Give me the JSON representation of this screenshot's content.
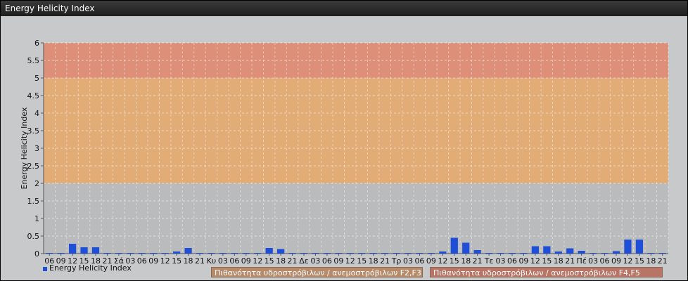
{
  "window": {
    "title": "Energy Helicity Index"
  },
  "chart_data": {
    "type": "bar",
    "ylabel": "Energy Helicity Index",
    "ylim": [
      0,
      6
    ],
    "yticks": [
      "0",
      "0.5",
      "1",
      "1.5",
      "2",
      "2.5",
      "3",
      "3.5",
      "4",
      "4.5",
      "5",
      "5.5",
      "6"
    ],
    "grid": true,
    "categories": [
      "06",
      "09",
      "12",
      "15",
      "18",
      "21",
      "Σά",
      "03",
      "06",
      "09",
      "12",
      "15",
      "18",
      "21",
      "Κυ",
      "03",
      "06",
      "09",
      "12",
      "15",
      "18",
      "21",
      "Δε",
      "03",
      "06",
      "09",
      "12",
      "15",
      "18",
      "21",
      "Τρ",
      "03",
      "06",
      "09",
      "12",
      "15",
      "18",
      "21",
      "Τε",
      "03",
      "06",
      "09",
      "12",
      "15",
      "18",
      "21",
      "Πέ",
      "03",
      "06",
      "09",
      "12",
      "15",
      "18",
      "21"
    ],
    "series": [
      {
        "name": "Energy Helicity Index",
        "color": "#1f4fd8",
        "values": [
          0.02,
          0.02,
          0.28,
          0.18,
          0.18,
          0.02,
          0.02,
          0.02,
          0.02,
          0.02,
          0.02,
          0.06,
          0.16,
          0.02,
          0.02,
          0.02,
          0.02,
          0.02,
          0.02,
          0.16,
          0.13,
          0.02,
          0.02,
          0.02,
          0.02,
          0.02,
          0.02,
          0.02,
          0.02,
          0.02,
          0.02,
          0.02,
          0.02,
          0.02,
          0.06,
          0.45,
          0.31,
          0.1,
          0.02,
          0.02,
          0.02,
          0.02,
          0.21,
          0.21,
          0.06,
          0.15,
          0.08,
          0.02,
          0.02,
          0.07,
          0.4,
          0.4,
          0.02,
          0.02
        ]
      }
    ],
    "bands": [
      {
        "from": 2,
        "to": 5,
        "label": "Πιθανότητα υδροστρόβιλων / ανεμοστρόβιλων F2,F3",
        "color": "#e7a96a"
      },
      {
        "from": 5,
        "to": 6,
        "label": "Πιθανότητα υδροστρόβιλων / ανεμοστρόβιλων F4,F5",
        "color": "#e3876e"
      }
    ],
    "legend": "bottom-left"
  }
}
